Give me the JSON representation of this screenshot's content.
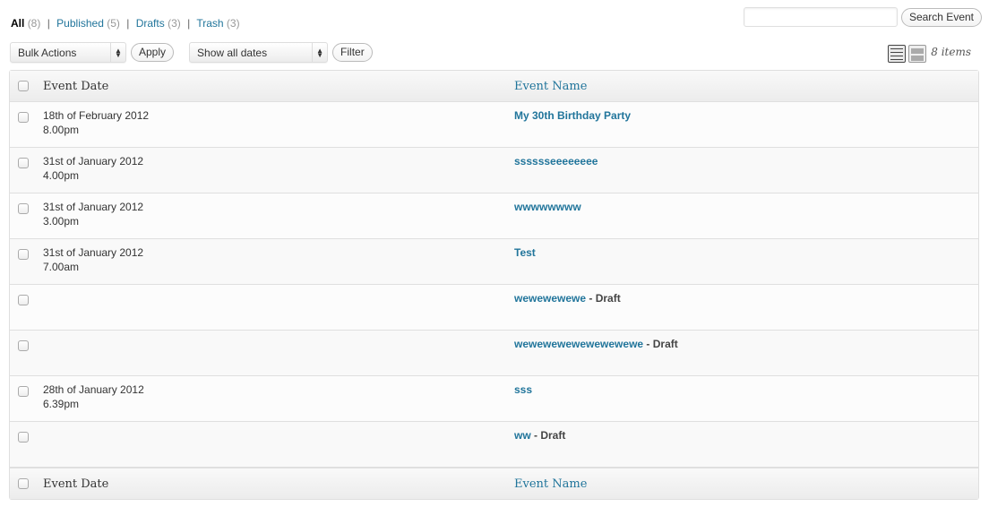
{
  "filters": {
    "all": {
      "label": "All",
      "count": "(8)"
    },
    "published": {
      "label": "Published",
      "count": "(5)"
    },
    "drafts": {
      "label": "Drafts",
      "count": "(3)"
    },
    "trash": {
      "label": "Trash",
      "count": "(3)"
    },
    "separator": "|"
  },
  "search": {
    "value": "",
    "placeholder": "",
    "button_label": "Search Event"
  },
  "tablenav": {
    "bulk_actions": "Bulk Actions",
    "apply_label": "Apply",
    "dates": "Show all dates",
    "filter_label": "Filter",
    "view_icons": [
      "list-view-icon",
      "excerpt-view-icon"
    ],
    "items_count": "8 items"
  },
  "table": {
    "columns": {
      "date": "Event Date",
      "name": "Event Name"
    },
    "draft_suffix": " - Draft",
    "rows": [
      {
        "date": "18th of February 2012",
        "time": "8.00pm",
        "name": "My 30th Birthday Party",
        "draft": false
      },
      {
        "date": "31st of January 2012",
        "time": "4.00pm",
        "name": "sssssseeeeeeee",
        "draft": false
      },
      {
        "date": "31st of January 2012",
        "time": "3.00pm",
        "name": "wwwwwwww",
        "draft": false
      },
      {
        "date": "31st of January 2012",
        "time": "7.00am",
        "name": "Test",
        "draft": false
      },
      {
        "date": "",
        "time": "",
        "name": "wewewewewe",
        "draft": true
      },
      {
        "date": "",
        "time": "",
        "name": "wewewewewewewewewe",
        "draft": true
      },
      {
        "date": "28th of January 2012",
        "time": "6.39pm",
        "name": "sss",
        "draft": false
      },
      {
        "date": "",
        "time": "",
        "name": "ww",
        "draft": true
      }
    ]
  },
  "colors": {
    "link": "#21759b",
    "text": "#333333",
    "border": "#dfdfdf"
  }
}
